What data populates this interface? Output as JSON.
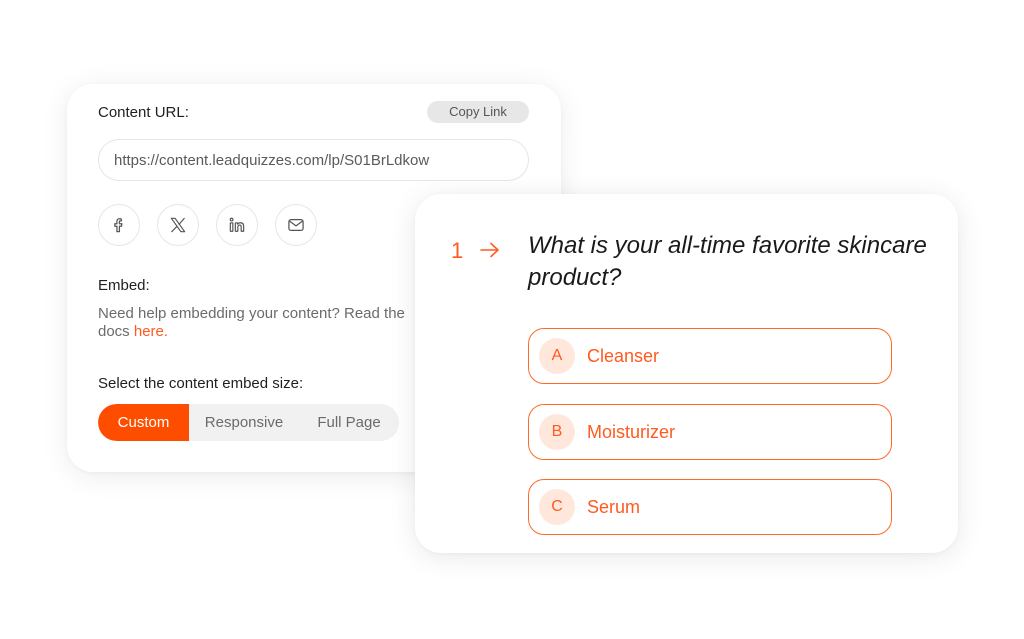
{
  "share": {
    "content_url_label": "Content URL:",
    "copy_link_label": "Copy Link",
    "url_value": "https://content.leadquizzes.com/lp/S01BrLdkow",
    "social": [
      {
        "icon": "facebook-icon"
      },
      {
        "icon": "x-twitter-icon"
      },
      {
        "icon": "linkedin-icon"
      },
      {
        "icon": "email-icon"
      }
    ],
    "embed_label": "Embed:",
    "embed_help_text": "Need help embedding your content? Read the docs ",
    "embed_help_link": "here.",
    "size_label": "Select the content embed size:",
    "size_options": [
      "Custom",
      "Responsive",
      "Full Page"
    ],
    "selected_size": "Custom"
  },
  "quiz": {
    "question_number": "1",
    "question_text": "What is your all-time favorite skincare product?",
    "answers": [
      {
        "key": "A",
        "label": "Cleanser"
      },
      {
        "key": "B",
        "label": "Moisturizer"
      },
      {
        "key": "C",
        "label": "Serum"
      }
    ]
  },
  "colors": {
    "accent": "#ff4d00",
    "accent_soft": "#ffe7dc",
    "text_dark": "#1f1f1f",
    "text_muted": "#6b6b6b"
  }
}
